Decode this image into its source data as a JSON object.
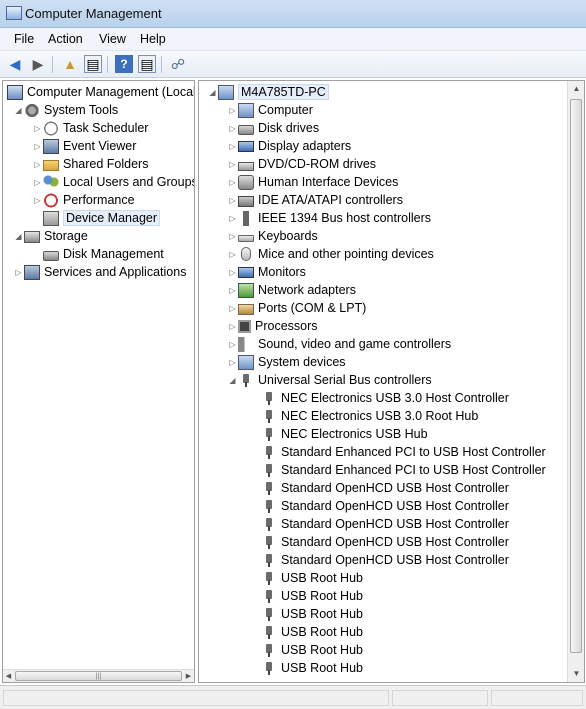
{
  "window": {
    "title": "Computer Management"
  },
  "menu": [
    "File",
    "Action",
    "View",
    "Help"
  ],
  "toolbar": {
    "icons": [
      "back-arrow-icon",
      "forward-arrow-icon",
      "up-folder-icon",
      "show-hide-tree-icon",
      "help-icon",
      "show-hide-action-pane-icon",
      "scan-hardware-icon"
    ]
  },
  "left_tree": {
    "root": "Computer Management (Local",
    "system_tools": "System Tools",
    "task_scheduler": "Task Scheduler",
    "event_viewer": "Event Viewer",
    "shared_folders": "Shared Folders",
    "local_users": "Local Users and Groups",
    "performance": "Performance",
    "device_manager": "Device Manager",
    "storage": "Storage",
    "disk_management": "Disk Management",
    "services": "Services and Applications"
  },
  "device_tree": {
    "root": "M4A785TD-PC",
    "categories": [
      "Computer",
      "Disk drives",
      "Display adapters",
      "DVD/CD-ROM drives",
      "Human Interface Devices",
      "IDE ATA/ATAPI controllers",
      "IEEE 1394 Bus host controllers",
      "Keyboards",
      "Mice and other pointing devices",
      "Monitors",
      "Network adapters",
      "Ports (COM & LPT)",
      "Processors",
      "Sound, video and game controllers",
      "System devices",
      "Universal Serial Bus controllers"
    ],
    "usb_children": [
      "NEC Electronics USB 3.0 Host Controller",
      "NEC Electronics USB 3.0 Root Hub",
      "NEC Electronics USB Hub",
      "Standard Enhanced PCI to USB Host Controller",
      "Standard Enhanced PCI to USB Host Controller",
      "Standard OpenHCD USB Host Controller",
      "Standard OpenHCD USB Host Controller",
      "Standard OpenHCD USB Host Controller",
      "Standard OpenHCD USB Host Controller",
      "Standard OpenHCD USB Host Controller",
      "USB Root Hub",
      "USB Root Hub",
      "USB Root Hub",
      "USB Root Hub",
      "USB Root Hub",
      "USB Root Hub"
    ]
  },
  "hscroll_grip": "|||"
}
